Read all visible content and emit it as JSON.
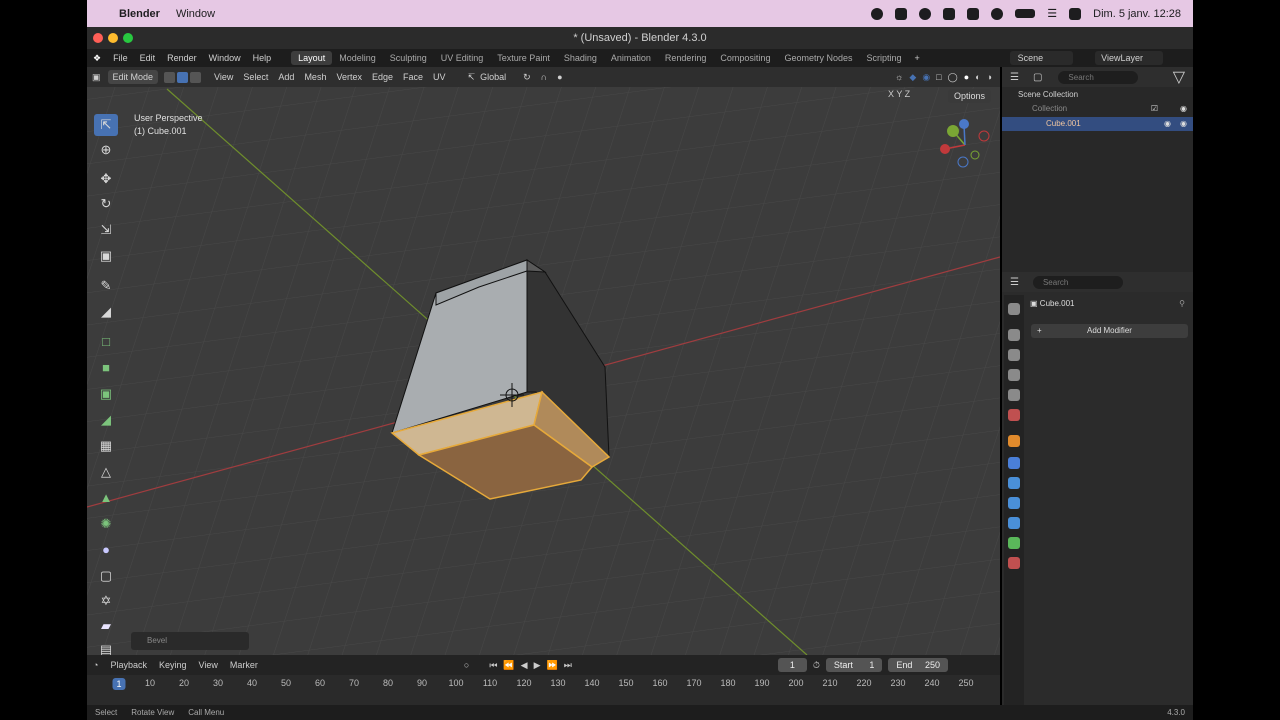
{
  "macos": {
    "app": "Blender",
    "menu": [
      "Window"
    ],
    "clock": "Dim. 5 janv.  12:28"
  },
  "window": {
    "title": "* (Unsaved) - Blender 4.3.0"
  },
  "topbar": {
    "menus": [
      "File",
      "Edit",
      "Render",
      "Window",
      "Help"
    ],
    "workspaces": [
      "Layout",
      "Modeling",
      "Sculpting",
      "UV Editing",
      "Texture Paint",
      "Shading",
      "Animation",
      "Rendering",
      "Compositing",
      "Geometry Nodes",
      "Scripting"
    ],
    "active_workspace": "Layout",
    "scene": "Scene",
    "view_layer": "ViewLayer"
  },
  "viewport": {
    "mode": "Edit Mode",
    "menus": [
      "View",
      "Select",
      "Add",
      "Mesh",
      "Vertex",
      "Edge",
      "Face",
      "UV"
    ],
    "orientation": "Global",
    "info_line1": "User Perspective",
    "info_line2": "(1) Cube.001",
    "options": "Options",
    "axes": "X  Y  Z",
    "last_op": "Bevel"
  },
  "timeline": {
    "menus": [
      "Playback",
      "Keying",
      "View",
      "Marker"
    ],
    "current_frame": "1",
    "start_label": "Start",
    "start": "1",
    "end_label": "End",
    "end": "250",
    "ticks": [
      "1",
      "10",
      "20",
      "30",
      "40",
      "50",
      "60",
      "70",
      "80",
      "90",
      "100",
      "110",
      "120",
      "130",
      "140",
      "150",
      "160",
      "170",
      "180",
      "190",
      "200",
      "210",
      "220",
      "230",
      "240",
      "250"
    ]
  },
  "statusbar": {
    "items": [
      "Select",
      "Rotate View",
      "Call Menu"
    ],
    "version": "4.3.0"
  },
  "outliner": {
    "search_placeholder": "Search",
    "rows": [
      "Scene Collection",
      "Collection",
      "Cube.001"
    ]
  },
  "properties": {
    "search_placeholder": "Search",
    "object_name": "Cube.001",
    "add_modifier": "Add Modifier"
  },
  "colors": {
    "accent": "#4772b3",
    "selection_face": "#e2a24d",
    "x_axis": "#c0393b",
    "y_axis": "#7aa634"
  }
}
